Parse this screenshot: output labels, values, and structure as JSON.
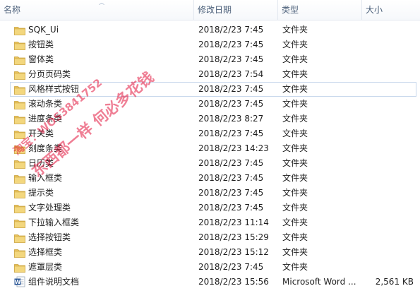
{
  "columns": {
    "name": "名称",
    "date": "修改日期",
    "type": "类型",
    "size": "大小"
  },
  "files": [
    {
      "name": "SQK_Ui",
      "date": "2018/2/23 7:45",
      "type": "文件夹",
      "size": "",
      "icon": "folder-icon"
    },
    {
      "name": "按钮类",
      "date": "2018/2/23 7:45",
      "type": "文件夹",
      "size": "",
      "icon": "folder-icon"
    },
    {
      "name": "窗体类",
      "date": "2018/2/23 7:45",
      "type": "文件夹",
      "size": "",
      "icon": "folder-icon"
    },
    {
      "name": "分页页码类",
      "date": "2018/2/23 7:54",
      "type": "文件夹",
      "size": "",
      "icon": "folder-icon"
    },
    {
      "name": "风格样式按钮",
      "date": "2018/2/23 7:45",
      "type": "文件夹",
      "size": "",
      "icon": "folder-icon",
      "selected": true
    },
    {
      "name": "滚动条类",
      "date": "2018/2/23 7:45",
      "type": "文件夹",
      "size": "",
      "icon": "folder-icon"
    },
    {
      "name": "进度条类",
      "date": "2018/2/23 8:27",
      "type": "文件夹",
      "size": "",
      "icon": "folder-icon"
    },
    {
      "name": "开关类",
      "date": "2018/2/23 7:45",
      "type": "文件夹",
      "size": "",
      "icon": "folder-icon"
    },
    {
      "name": "刻度条类",
      "date": "2018/2/23 14:23",
      "type": "文件夹",
      "size": "",
      "icon": "folder-icon"
    },
    {
      "name": "日历类",
      "date": "2018/2/23 7:45",
      "type": "文件夹",
      "size": "",
      "icon": "folder-icon"
    },
    {
      "name": "输入框类",
      "date": "2018/2/23 7:45",
      "type": "文件夹",
      "size": "",
      "icon": "folder-icon"
    },
    {
      "name": "提示类",
      "date": "2018/2/23 7:45",
      "type": "文件夹",
      "size": "",
      "icon": "folder-icon"
    },
    {
      "name": "文字处理类",
      "date": "2018/2/23 7:45",
      "type": "文件夹",
      "size": "",
      "icon": "folder-icon"
    },
    {
      "name": "下拉输入框类",
      "date": "2018/2/23 11:14",
      "type": "文件夹",
      "size": "",
      "icon": "folder-icon"
    },
    {
      "name": "选择按钮类",
      "date": "2018/2/23 15:29",
      "type": "文件夹",
      "size": "",
      "icon": "folder-icon"
    },
    {
      "name": "选择框类",
      "date": "2018/2/23 15:12",
      "type": "文件夹",
      "size": "",
      "icon": "folder-icon"
    },
    {
      "name": "遮罩层类",
      "date": "2018/2/23 7:45",
      "type": "文件夹",
      "size": "",
      "icon": "folder-icon"
    },
    {
      "name": "组件说明文档",
      "date": "2018/2/23 15:56",
      "type": "Microsoft Word ...",
      "size": "2,561 KB",
      "icon": "word-document-icon"
    }
  ],
  "watermark": {
    "line1": "淘宝：WOS3841752",
    "line2": "东西都一样 何必多花钱"
  },
  "colors": {
    "header_text": "#4c607a",
    "folder": "#e8c15a",
    "word_blue": "#2b5797",
    "watermark": "#e1143c"
  }
}
